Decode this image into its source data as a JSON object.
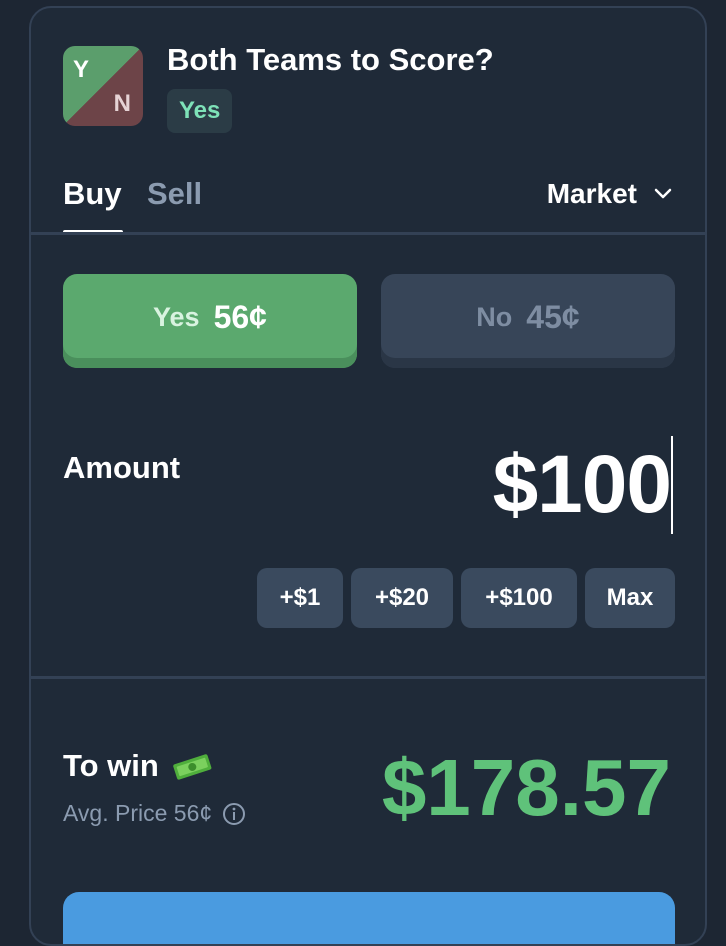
{
  "market": {
    "icon_yes_letter": "Y",
    "icon_no_letter": "N",
    "title": "Both Teams to Score?",
    "selected_outcome": "Yes"
  },
  "tabs": {
    "buy": "Buy",
    "sell": "Sell",
    "active": "Buy"
  },
  "order_type": {
    "label": "Market",
    "icon": "chevron-down-icon"
  },
  "outcomes": {
    "yes": {
      "label": "Yes",
      "price": "56¢",
      "selected": true
    },
    "no": {
      "label": "No",
      "price": "45¢",
      "selected": false
    }
  },
  "amount": {
    "label": "Amount",
    "value": "$100"
  },
  "quick_add": [
    "+$1",
    "+$20",
    "+$100",
    "Max"
  ],
  "summary": {
    "to_win_label": "To win",
    "to_win_icon": "money-icon",
    "avg_price": "Avg. Price 56¢",
    "info_icon": "info-icon",
    "to_win_value": "$178.57"
  },
  "colors": {
    "background": "#1f2a38",
    "yes_green": "#5ba96e",
    "win_green": "#5fc27a",
    "no_gray": "#374558",
    "badge_text": "#7ee2b8",
    "action_blue": "#4a9be0"
  }
}
